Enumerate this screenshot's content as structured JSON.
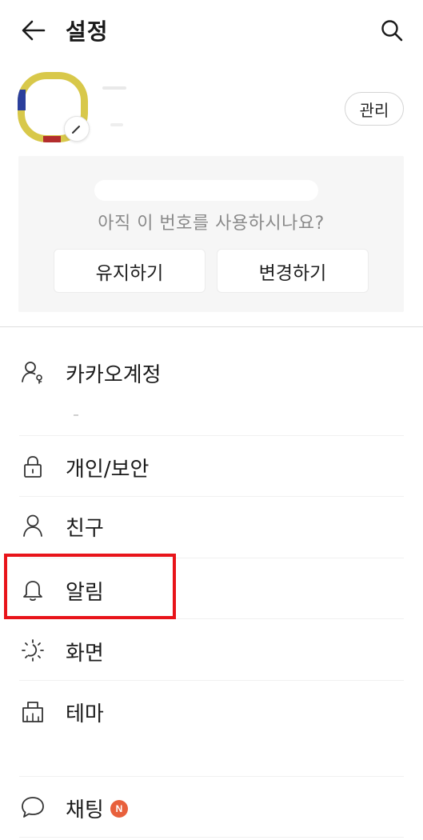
{
  "header": {
    "title": "설정",
    "back_icon": "arrow-left-icon",
    "search_icon": "search-icon"
  },
  "profile": {
    "manage_label": "관리",
    "badge_icon": "edit-badge-icon"
  },
  "number_card": {
    "question": "아직 이 번호를 사용하시나요?",
    "keep_label": "유지하기",
    "change_label": "변경하기"
  },
  "menu": {
    "items": [
      {
        "label": "카카오계정",
        "icon": "account-icon"
      },
      {
        "label": "개인/보안",
        "icon": "lock-icon"
      },
      {
        "label": "친구",
        "icon": "person-icon"
      },
      {
        "label": "알림",
        "icon": "bell-icon"
      },
      {
        "label": "화면",
        "icon": "brightness-icon"
      },
      {
        "label": "테마",
        "icon": "theme-icon"
      },
      {
        "label": "채팅",
        "icon": "chat-bubble-icon",
        "badge": "N"
      }
    ]
  },
  "colors": {
    "highlight": "#e8141a",
    "new_badge": "#e8603c",
    "card_background": "#f6f6f6"
  }
}
